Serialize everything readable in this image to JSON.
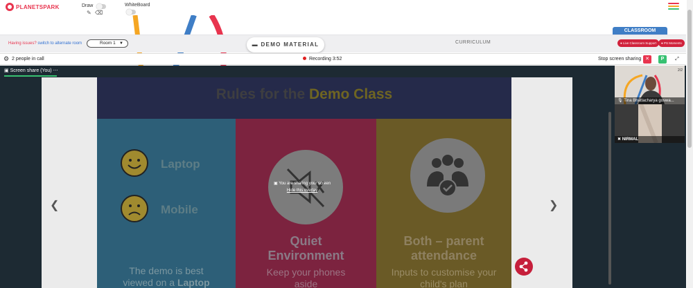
{
  "brand": {
    "name": "PLANETSPARK"
  },
  "toolbar": {
    "draw_label": "Draw",
    "whiteboard_label": "WhiteBoard"
  },
  "room_bar": {
    "issues_text": "Having issues?",
    "switch_text": "switch to alternate room",
    "room_selected": "Room 1",
    "demo_material_label": "DEMO MATERIAL",
    "curriculum_label": "CURRICULUM",
    "classroom_tab": "CLASSROOM",
    "live_support_label": "Live Classroom Support",
    "ps_moments_label": "PS Moments"
  },
  "call_bar": {
    "people_in_call": "2 people in call",
    "recording_label": "Recording",
    "recording_time": "3:52",
    "stop_sharing_label": "Stop screen sharing",
    "p_label": "P"
  },
  "share": {
    "tab_label": "Screen share (You)",
    "tab_more": "⋯",
    "overlay_message": "You are sharing your screen",
    "overlay_hide": "Hide this overlay",
    "page_indicator": "2/2"
  },
  "slide": {
    "title_part1": "Rules for the ",
    "title_part2": "Demo Class",
    "laptop_label": "Laptop",
    "mobile_label": "Mobile",
    "blue_body_line1": "The demo is best",
    "blue_body_line2_part1": "viewed on a ",
    "blue_body_line2_part2": "Laptop",
    "quiet_title_line1": "Quiet",
    "quiet_title_line2": "Environment",
    "quiet_body_line1": "Keep your phones",
    "quiet_body_line2": "aside",
    "parent_title_line1": "Both – parent",
    "parent_title_line2": "attendance",
    "parent_body_line1": "Inputs to customise your",
    "parent_body_line2": "child's plan"
  },
  "participants": [
    {
      "name": "Tina Bhattacharya goswa..."
    },
    {
      "name": "NIRMAL"
    }
  ],
  "colors": {
    "accent_red": "#d1223c",
    "classroom_blue": "#3f7ec6",
    "share_green": "#38c172",
    "slide_navy": "#252a4a"
  },
  "icons": {
    "settings": "gear-icon",
    "prev": "chevron-left-icon",
    "next": "chevron-right-icon",
    "share": "share-icon",
    "mute": "muted-speaker-icon",
    "family": "family-group-icon"
  }
}
